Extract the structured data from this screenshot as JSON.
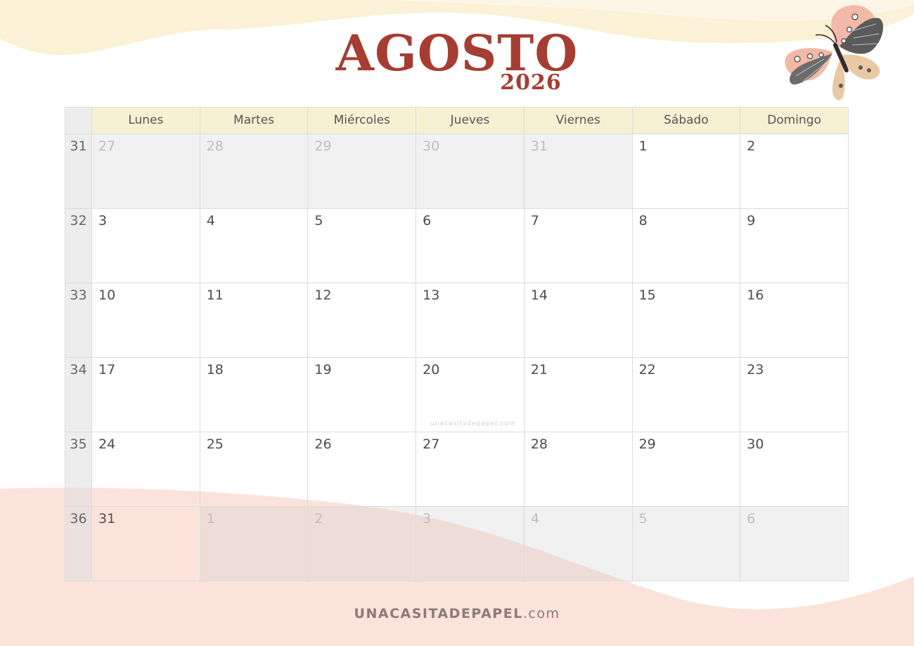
{
  "header": {
    "month": "AGOSTO",
    "year": "2026"
  },
  "weekdays": [
    "Lunes",
    "Martes",
    "Miércoles",
    "Jueves",
    "Viernes",
    "Sábado",
    "Domingo"
  ],
  "weeks": [
    {
      "number": "31",
      "days": [
        {
          "d": "27",
          "muted": true
        },
        {
          "d": "28",
          "muted": true
        },
        {
          "d": "29",
          "muted": true
        },
        {
          "d": "30",
          "muted": true
        },
        {
          "d": "31",
          "muted": true
        },
        {
          "d": "1",
          "muted": false
        },
        {
          "d": "2",
          "muted": false
        }
      ]
    },
    {
      "number": "32",
      "days": [
        {
          "d": "3",
          "muted": false
        },
        {
          "d": "4",
          "muted": false
        },
        {
          "d": "5",
          "muted": false
        },
        {
          "d": "6",
          "muted": false
        },
        {
          "d": "7",
          "muted": false
        },
        {
          "d": "8",
          "muted": false
        },
        {
          "d": "9",
          "muted": false
        }
      ]
    },
    {
      "number": "33",
      "days": [
        {
          "d": "10",
          "muted": false
        },
        {
          "d": "11",
          "muted": false
        },
        {
          "d": "12",
          "muted": false
        },
        {
          "d": "13",
          "muted": false
        },
        {
          "d": "14",
          "muted": false
        },
        {
          "d": "15",
          "muted": false
        },
        {
          "d": "16",
          "muted": false
        }
      ]
    },
    {
      "number": "34",
      "days": [
        {
          "d": "17",
          "muted": false
        },
        {
          "d": "18",
          "muted": false
        },
        {
          "d": "19",
          "muted": false
        },
        {
          "d": "20",
          "muted": false
        },
        {
          "d": "21",
          "muted": false
        },
        {
          "d": "22",
          "muted": false
        },
        {
          "d": "23",
          "muted": false
        }
      ]
    },
    {
      "number": "35",
      "days": [
        {
          "d": "24",
          "muted": false
        },
        {
          "d": "25",
          "muted": false
        },
        {
          "d": "26",
          "muted": false
        },
        {
          "d": "27",
          "muted": false
        },
        {
          "d": "28",
          "muted": false
        },
        {
          "d": "29",
          "muted": false
        },
        {
          "d": "30",
          "muted": false
        }
      ]
    },
    {
      "number": "36",
      "days": [
        {
          "d": "31",
          "muted": false
        },
        {
          "d": "1",
          "muted": true
        },
        {
          "d": "2",
          "muted": true
        },
        {
          "d": "3",
          "muted": true
        },
        {
          "d": "4",
          "muted": true
        },
        {
          "d": "5",
          "muted": true
        },
        {
          "d": "6",
          "muted": true
        }
      ]
    }
  ],
  "watermark": "unacasitadepapel.com",
  "footer": {
    "brand": "UNACASITADEPAPEL",
    "suffix": ".com"
  },
  "colors": {
    "title": "#a63d33",
    "header_bg": "#f8f0d2",
    "cream_wave": "#faf1d6",
    "pink_wave": "#fbe3dc"
  },
  "decoration": {
    "icon": "butterfly-icon"
  }
}
